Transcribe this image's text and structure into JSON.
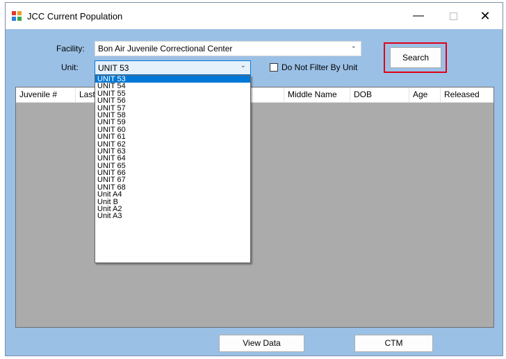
{
  "window": {
    "title": "JCC Current Population"
  },
  "filters": {
    "facility_label": "Facility:",
    "facility_value": "Bon Air Juvenile Correctional Center",
    "unit_label": "Unit:",
    "unit_value": "UNIT 53",
    "no_filter_label": "Do Not Filter By Unit",
    "no_filter_checked": false
  },
  "buttons": {
    "search": "Search",
    "view_data": "View Data",
    "ctm": "CTM"
  },
  "grid": {
    "columns": [
      "Juvenile #",
      "Last",
      "Middle Name",
      "DOB",
      "Age",
      "Released"
    ]
  },
  "unit_options": [
    "UNIT 53",
    "UNIT 54",
    "UNIT 55",
    "UNIT 56",
    "UNIT 57",
    "UNIT 58",
    "UNIT 59",
    "UNIT 60",
    "UNIT 61",
    "UNIT 62",
    "UNIT 63",
    "UNIT 64",
    "UNIT 65",
    "UNIT 66",
    "UNIT 67",
    "UNIT 68",
    "Unit A4",
    "Unit B",
    "Unit A2",
    "Unit A3"
  ],
  "selected_unit_index": 0,
  "colors": {
    "form_bg": "#9bc0e6",
    "grid_bg": "#ababab",
    "selection": "#0078d7",
    "highlight": "#e00016"
  }
}
